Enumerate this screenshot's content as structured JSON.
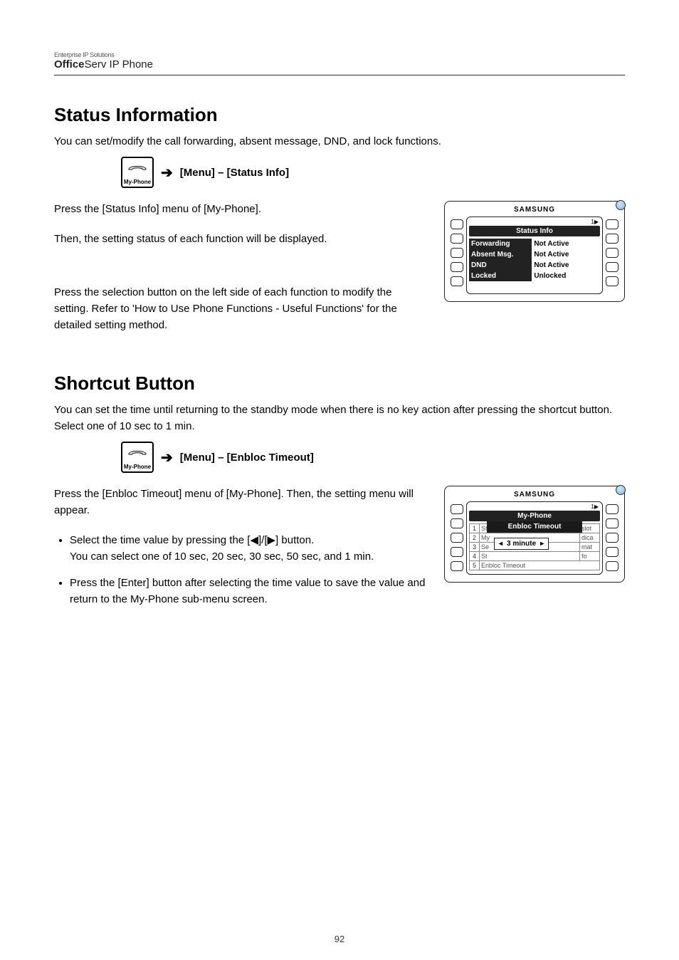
{
  "brand": {
    "smallLine": "Enterprise IP Solutions",
    "bigPrefix": "Office",
    "bigRest": "Serv IP Phone"
  },
  "myphone": {
    "label": "My-Phone"
  },
  "section1": {
    "title": "Status Information",
    "p1": "You can set/modify the call forwarding, absent message, DND, and lock functions.",
    "navMenu": "[Menu] – [Status Info]",
    "step1a": "Press the [Status Info] menu of [My-Phone].",
    "step1b": "Then, the setting status of each function will be displayed.",
    "step2": "Press the selection button on the left side of each function to modify the setting. Refer to 'How to Use Phone Functions - Useful Functions' for the detailed setting method."
  },
  "section2": {
    "title": "Shortcut Button",
    "p1": "You can set the time until returning to the standby mode when there is no key action after pressing the shortcut button. Select one of 10 sec to 1 min.",
    "navMenu": "[Menu] – [Enbloc Timeout]",
    "step1": "Press the [Enbloc Timeout] menu of [My-Phone]. Then, the setting menu will appear.",
    "bullet1a": "Select the time value by pressing the [◀]/[▶] button.",
    "bullet1b": "You can select one of 10 sec, 20 sec, 30 sec, 50 sec, and 1 min.",
    "bullet2": "Press the [Enter] button after selecting the time value to save the value and return to the My-Phone sub-menu screen."
  },
  "phone1": {
    "brand": "SAMSUNG",
    "cornerFlag": "1▶",
    "title": "Status Info",
    "rows": [
      {
        "label": "Forwarding",
        "value": "Not Active"
      },
      {
        "label": "Absent Msg.",
        "value": "Not Active"
      },
      {
        "label": "DND",
        "value": "Not Active"
      },
      {
        "label": "Locked",
        "value": "Unlocked"
      }
    ]
  },
  "phone2": {
    "brand": "SAMSUNG",
    "cornerFlag": "1▶",
    "title": "My-Phone",
    "list": [
      {
        "n": "1",
        "name": "St",
        "right": "slot"
      },
      {
        "n": "2",
        "name": "My",
        "right": "dica"
      },
      {
        "n": "3",
        "name": "Se",
        "right": "mat"
      },
      {
        "n": "4",
        "name": "St",
        "right": "fo"
      },
      {
        "n": "5",
        "name": "Enbloc Timeout",
        "right": ""
      }
    ],
    "popupTitle": "Enbloc Timeout",
    "popupValue": "3 minute"
  },
  "pageNumber": "92"
}
